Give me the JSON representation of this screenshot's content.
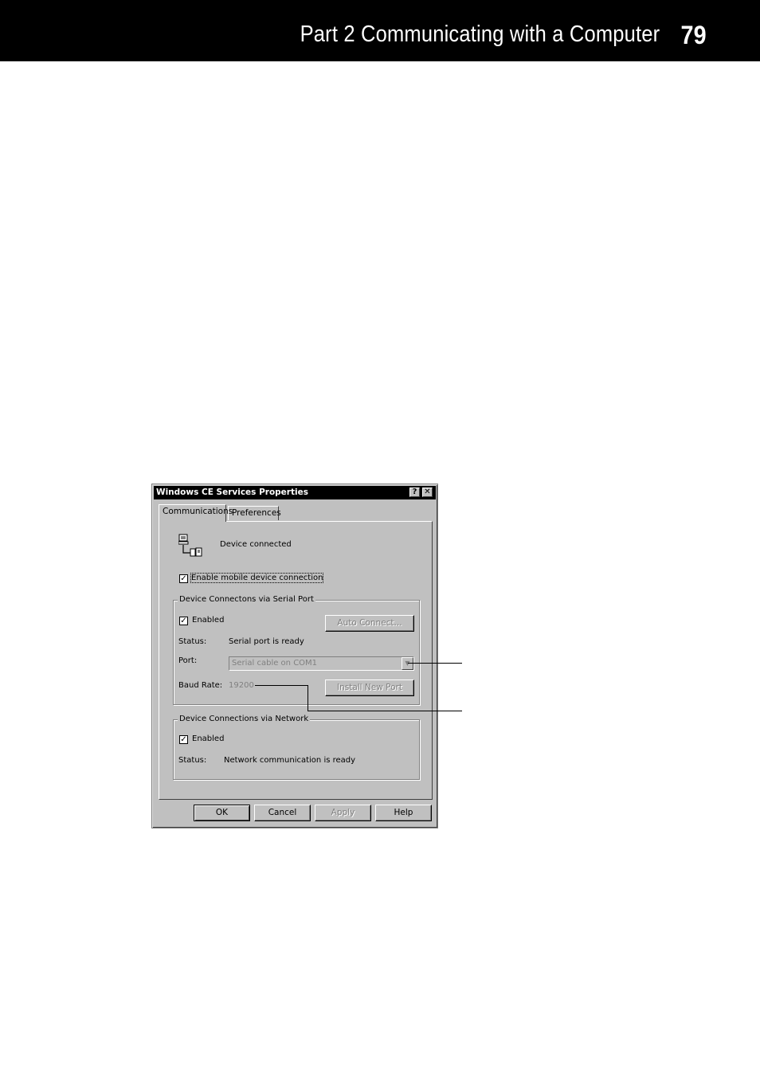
{
  "header": {
    "title": "Part 2  Communicating with a Computer",
    "page_number": "79"
  },
  "dialog": {
    "title": "Windows CE Services Properties",
    "help_button": "?",
    "close_button": "✕",
    "tabs": [
      {
        "label": "Communications",
        "active": true
      },
      {
        "label": "Preferences",
        "active": false
      }
    ],
    "device_status": "Device connected",
    "enable_connection_label": "Enable mobile device connection",
    "enable_connection_checked": true,
    "serial_group": {
      "legend": "Device Connectons via Serial Port",
      "enabled_label": "Enabled",
      "enabled_checked": true,
      "auto_connect_button": "Auto Connect...",
      "status_label": "Status:",
      "status_value": "Serial port is ready",
      "port_label": "Port:",
      "port_value": "Serial cable on COM1",
      "baud_label": "Baud Rate:",
      "baud_value": "19200",
      "install_port_button": "Install New Port"
    },
    "network_group": {
      "legend": "Device Connections via Network",
      "enabled_label": "Enabled",
      "enabled_checked": true,
      "status_label": "Status:",
      "status_value": "Network communication is ready"
    },
    "buttons": {
      "ok": "OK",
      "cancel": "Cancel",
      "apply": "Apply",
      "help": "Help"
    }
  }
}
